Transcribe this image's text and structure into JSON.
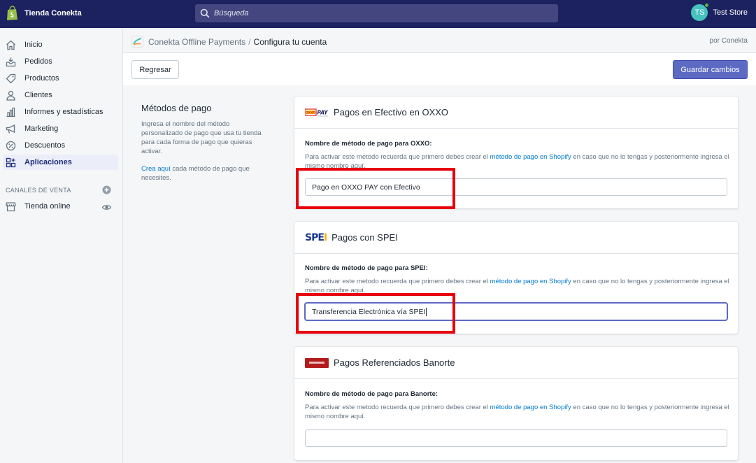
{
  "topbar": {
    "store_name": "Tienda Conekta",
    "search_placeholder": "Búsqueda",
    "avatar_initials": "TS",
    "account_name": "Test Store",
    "colors": {
      "bar": "#1c2260",
      "avatar": "#47c1bf"
    }
  },
  "sidebar": {
    "items": [
      {
        "label": "Inicio",
        "icon": "home-icon"
      },
      {
        "label": "Pedidos",
        "icon": "orders-icon"
      },
      {
        "label": "Productos",
        "icon": "tag-icon"
      },
      {
        "label": "Clientes",
        "icon": "person-icon"
      },
      {
        "label": "Informes y estadísticas",
        "icon": "chart-icon"
      },
      {
        "label": "Marketing",
        "icon": "megaphone-icon"
      },
      {
        "label": "Descuentos",
        "icon": "discount-icon"
      },
      {
        "label": "Aplicaciones",
        "icon": "apps-icon",
        "active": true
      }
    ],
    "channels_heading": "CANALES DE VENTA",
    "channel_items": [
      {
        "label": "Tienda online",
        "icon": "store-icon"
      }
    ]
  },
  "header": {
    "app_name": "Conekta Offline Payments",
    "separator": "/",
    "page_title": "Configura tu cuenta",
    "by_label": "por Conekta",
    "back_button": "Regresar",
    "save_button": "Guardar cambios",
    "accent": "#5c6ac4"
  },
  "annotation": {
    "title": "Métodos de pago",
    "description": "Ingresa el nombre del método personalizado de pago que usa tu tienda para cada forma de pago que quieras activar.",
    "link_text": "Crea aquí",
    "link_rest": " cada método de pago que necesites."
  },
  "cards": [
    {
      "logo": "oxxo-pay-logo",
      "logo_text": "PAY",
      "title": "Pagos en Efectivo en OXXO",
      "field_label": "Nombre de método de pago para OXXO:",
      "help_before": "Para activar este metodo recuerda que primero debes crear el ",
      "help_link": "método de pago en Shopify",
      "help_after": " en caso que no lo tengas y posteriormente ingresa el mismo nombre aquí.",
      "value": "Pago en OXXO PAY con Efectivo"
    },
    {
      "logo": "spei-logo",
      "logo_text": "SPEI",
      "title": "Pagos con SPEI",
      "field_label": "Nombre de método de pago para SPEI:",
      "help_before": "Para activar este metodo recuerda que primero debes crear el ",
      "help_link": "método de pago en Shopify",
      "help_after": " en caso que no lo tengas y posteriormente ingresa el mismo nombre aquí.",
      "value": "Transferencia Electrónica vía SPEI"
    },
    {
      "logo": "banorte-logo",
      "title": "Pagos Referenciados Banorte",
      "field_label": "Nombre de método de pago para Banorte:",
      "help_before": "Para activar este metodo recuerda que primero debes crear el ",
      "help_link": "método de pago en Shopify",
      "help_after": " en caso que no lo tengas y posteriormente ingresa el mismo nombre aquí.",
      "value": ""
    }
  ],
  "highlight_color": "#e8000b"
}
